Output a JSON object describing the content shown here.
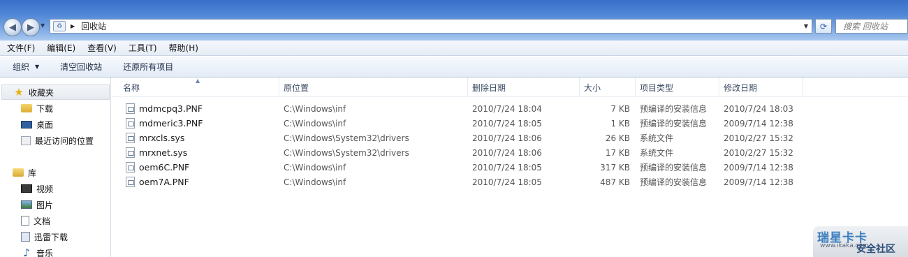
{
  "address": {
    "path": "回收站",
    "search_placeholder": "搜索 回收站"
  },
  "menu": [
    "文件(F)",
    "编辑(E)",
    "查看(V)",
    "工具(T)",
    "帮助(H)"
  ],
  "toolbar": {
    "organize": "组织",
    "empty_bin": "清空回收站",
    "restore_all": "还原所有项目"
  },
  "navigation": {
    "favorites_label": "收藏夹",
    "favorites": [
      {
        "label": "下载",
        "icon": "download-folder-icon"
      },
      {
        "label": "桌面",
        "icon": "desktop-icon"
      },
      {
        "label": "最近访问的位置",
        "icon": "recent-places-icon"
      }
    ],
    "library_label": "库",
    "libraries": [
      {
        "label": "视频",
        "icon": "video-icon"
      },
      {
        "label": "图片",
        "icon": "picture-icon"
      },
      {
        "label": "文档",
        "icon": "document-icon"
      },
      {
        "label": "迅雷下载",
        "icon": "xunlei-icon"
      },
      {
        "label": "音乐",
        "icon": "music-icon"
      }
    ]
  },
  "columns": {
    "name": "名称",
    "original_location": "原位置",
    "date_deleted": "删除日期",
    "size": "大小",
    "item_type": "项目类型",
    "date_modified": "修改日期"
  },
  "files": [
    {
      "name": "mdmcpq3.PNF",
      "location": "C:\\Windows\\inf",
      "deleted": "2010/7/24 18:04",
      "size": "7 KB",
      "type": "预编译的安装信息",
      "modified": "2010/7/24 18:03"
    },
    {
      "name": "mdmeric3.PNF",
      "location": "C:\\Windows\\inf",
      "deleted": "2010/7/24 18:05",
      "size": "1 KB",
      "type": "预编译的安装信息",
      "modified": "2009/7/14 12:38"
    },
    {
      "name": "mrxcls.sys",
      "location": "C:\\Windows\\System32\\drivers",
      "deleted": "2010/7/24 18:06",
      "size": "26 KB",
      "type": "系统文件",
      "modified": "2010/2/27 15:32"
    },
    {
      "name": "mrxnet.sys",
      "location": "C:\\Windows\\System32\\drivers",
      "deleted": "2010/7/24 18:06",
      "size": "17 KB",
      "type": "系统文件",
      "modified": "2010/2/27 15:32"
    },
    {
      "name": "oem6C.PNF",
      "location": "C:\\Windows\\inf",
      "deleted": "2010/7/24 18:05",
      "size": "317 KB",
      "type": "预编译的安装信息",
      "modified": "2009/7/14 12:38"
    },
    {
      "name": "oem7A.PNF",
      "location": "C:\\Windows\\inf",
      "deleted": "2010/7/24 18:05",
      "size": "487 KB",
      "type": "预编译的安装信息",
      "modified": "2009/7/14 12:38"
    }
  ],
  "watermark": {
    "main": "瑞星卡卡",
    "sub": "www.ikaka.com",
    "big": "安全社区"
  },
  "colors": {
    "titlebar": "#4f86d6",
    "accent": "#3e7fc0"
  }
}
